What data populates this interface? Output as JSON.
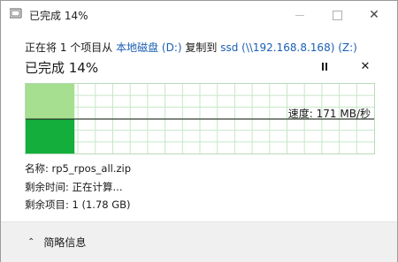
{
  "window": {
    "title": "已完成 14%"
  },
  "transfer": {
    "prefix": "正在将 1 个项目从 ",
    "source": "本地磁盘 (D:)",
    "middle": " 复制到 ",
    "destination": "ssd (\\\\192.168.8.168) (Z:)",
    "progress_title": "已完成 14%",
    "percent_complete": 14
  },
  "graph": {
    "speed_label": "速度: 171 MB/秒"
  },
  "details": {
    "name_label": "名称: rp5_rpos_all.zip",
    "time_label": "剩余时间: 正在计算...",
    "items_label": "剩余项目: 1 (1.78 GB)"
  },
  "footer": {
    "toggle_label": "简略信息"
  },
  "colors": {
    "graph_fill": "#13ae3b",
    "graph_fill_light": "#a6df8f",
    "grid": "#c7e7c7",
    "link": "#1a5fb4"
  }
}
